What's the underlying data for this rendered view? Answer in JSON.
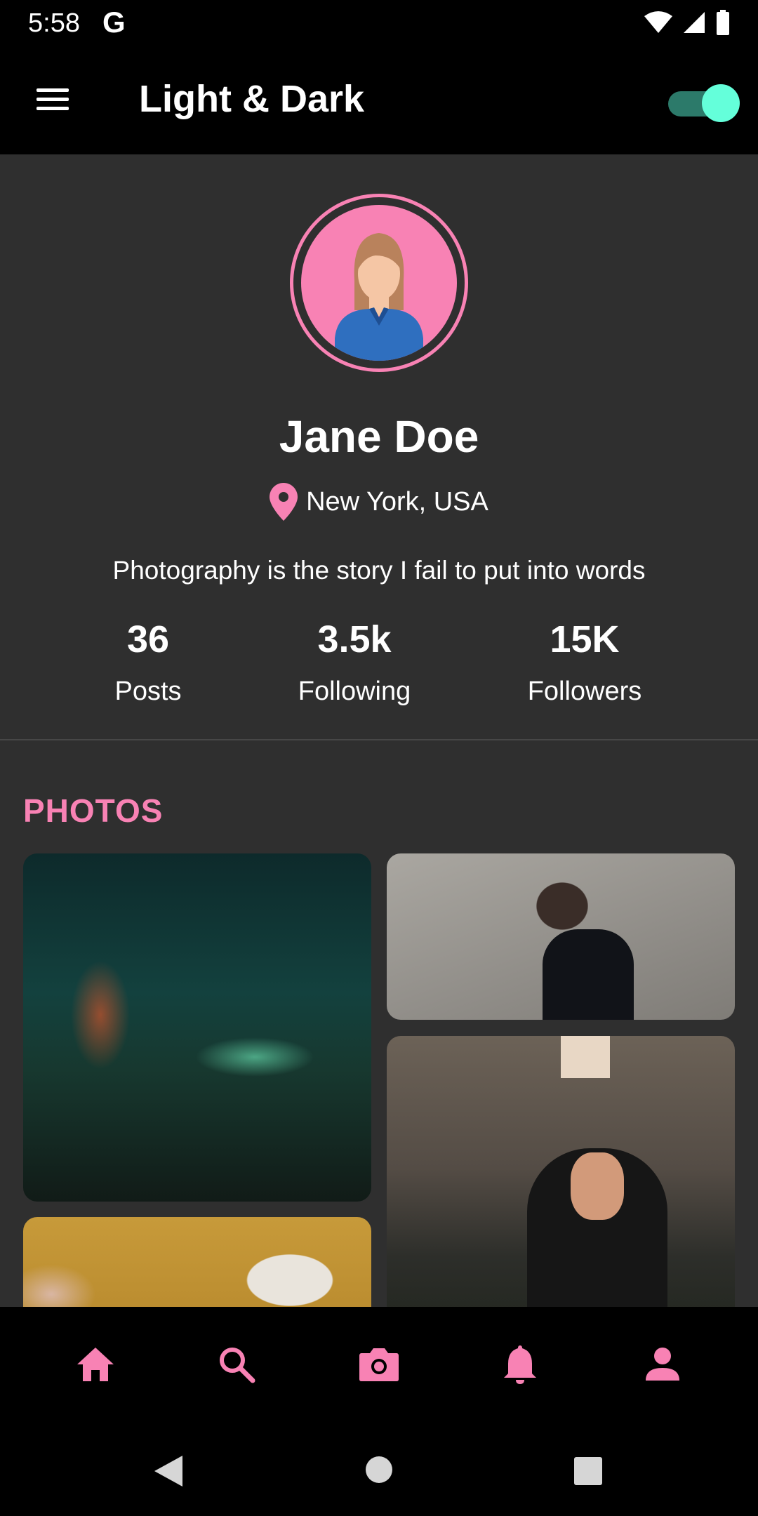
{
  "status_bar": {
    "time": "5:58",
    "google_glyph": "G",
    "icons": [
      "wifi-icon",
      "cell-signal-icon",
      "battery-icon"
    ]
  },
  "app_bar": {
    "title": "Light & Dark",
    "menu_icon": "hamburger-menu-icon",
    "dark_mode_toggle": true
  },
  "profile": {
    "name": "Jane Doe",
    "location": "New York, USA",
    "bio": "Photography is the story I fail to put into words",
    "stats": [
      {
        "value": "36",
        "label": "Posts"
      },
      {
        "value": "3.5k",
        "label": "Following"
      },
      {
        "value": "15K",
        "label": "Followers"
      }
    ]
  },
  "photos_section": {
    "title": "PHOTOS"
  },
  "bottom_nav": {
    "items": [
      "home-icon",
      "search-icon",
      "camera-icon",
      "bell-icon",
      "person-icon"
    ]
  },
  "system_nav": {
    "items": [
      "back-icon",
      "home-circle-icon",
      "recents-icon"
    ]
  },
  "colors": {
    "accent": "#f882b4",
    "toggle_thumb": "#64ffda",
    "background": "#2f2f2f",
    "bar": "#000000"
  }
}
